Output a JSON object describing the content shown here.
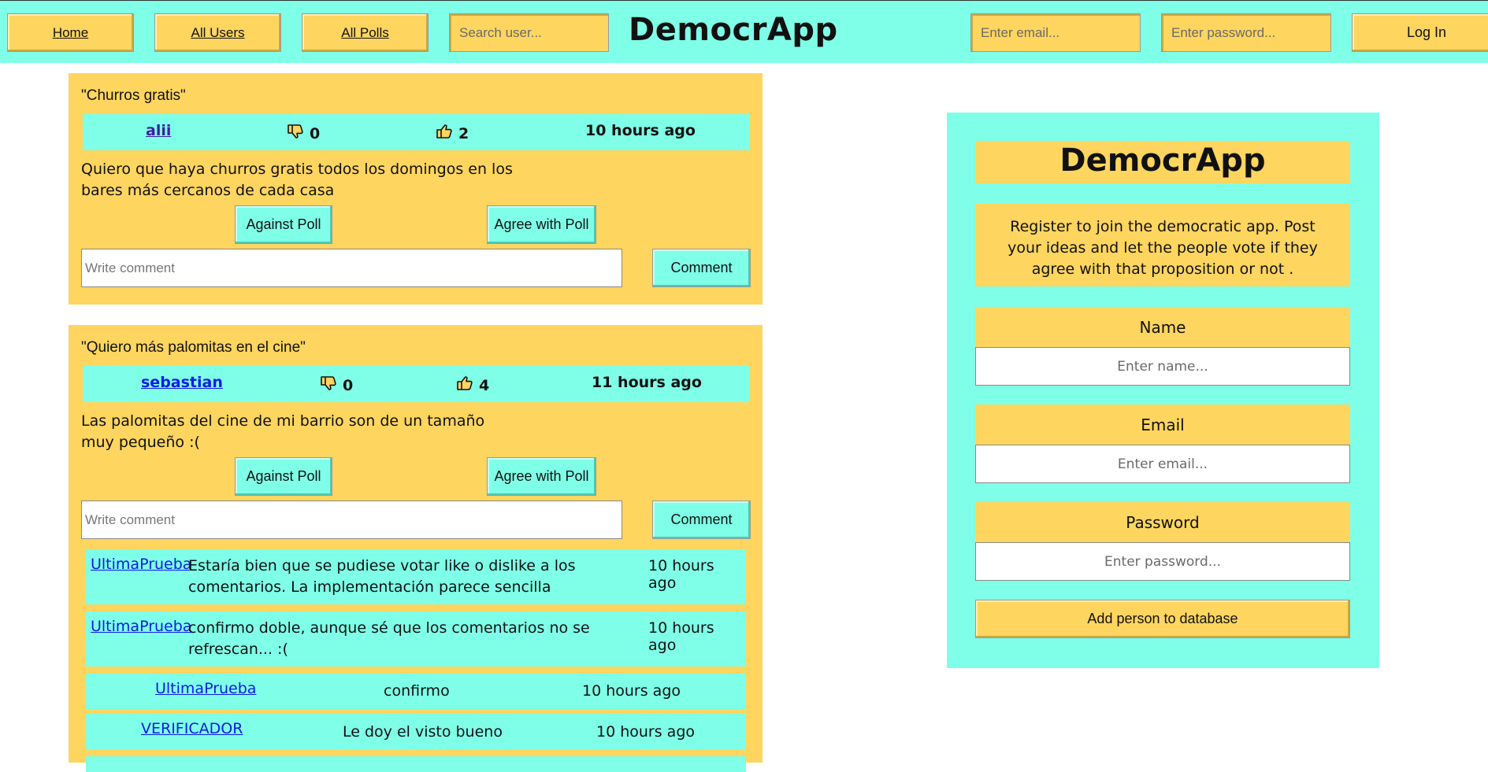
{
  "navbar": {
    "home_label": "Home",
    "all_users_label": "All Users",
    "all_polls_label": "All Polls",
    "search_placeholder": "Search user...",
    "brand": "DemocrApp",
    "email_placeholder": "Enter email...",
    "password_placeholder": "Enter password...",
    "login_label": "Log In"
  },
  "polls": [
    {
      "title": "\"Churros gratis\"",
      "author": "alii",
      "dislikes": "0",
      "likes": "2",
      "time": "10 hours ago",
      "description": "Quiero que haya churros gratis todos los domingos en los bares más cercanos de cada casa",
      "against_label": "Against Poll",
      "agree_label": "Agree with Poll",
      "comment_placeholder": "Write comment",
      "comment_button": "Comment"
    },
    {
      "title": "\"Quiero más palomitas en el cine\"",
      "author": "sebastian",
      "dislikes": "0",
      "likes": "4",
      "time": "11 hours ago",
      "description": "Las palomitas del cine de mi barrio son de un tamaño muy pequeño :(",
      "against_label": "Against Poll",
      "agree_label": "Agree with Poll",
      "comment_placeholder": "Write comment",
      "comment_button": "Comment",
      "comments": [
        {
          "user": "UltimaPrueba",
          "text": "Estaría bien que se pudiese votar like o dislike a los comentarios. La implementación parece sencilla",
          "time": "10 hours ago"
        },
        {
          "user": "UltimaPrueba",
          "text": "confirmo doble, aunque sé que los comentarios no se refrescan... :(",
          "time": "10 hours ago"
        },
        {
          "user": "UltimaPrueba",
          "text": "confirmo",
          "time": "10 hours ago"
        },
        {
          "user": "VERIFICADOR",
          "text": "Le doy el visto bueno",
          "time": "10 hours ago"
        }
      ]
    }
  ],
  "register": {
    "title": "DemocrApp",
    "description": "Register to join the democratic app. Post your ideas and let the people vote if they agree with that proposition or not .",
    "name_label": "Name",
    "name_placeholder": "Enter name...",
    "email_label": "Email",
    "email_placeholder": "Enter email...",
    "password_label": "Password",
    "password_placeholder": "Enter password...",
    "submit_label": "Add person to database"
  },
  "colors": {
    "aqua": "#7fffe8",
    "yellow": "#fdd55f",
    "link_purple": "#3b1fa8",
    "link_blue": "#0b1be6"
  },
  "icons": [
    "thumbs-down-icon",
    "thumbs-up-icon"
  ]
}
